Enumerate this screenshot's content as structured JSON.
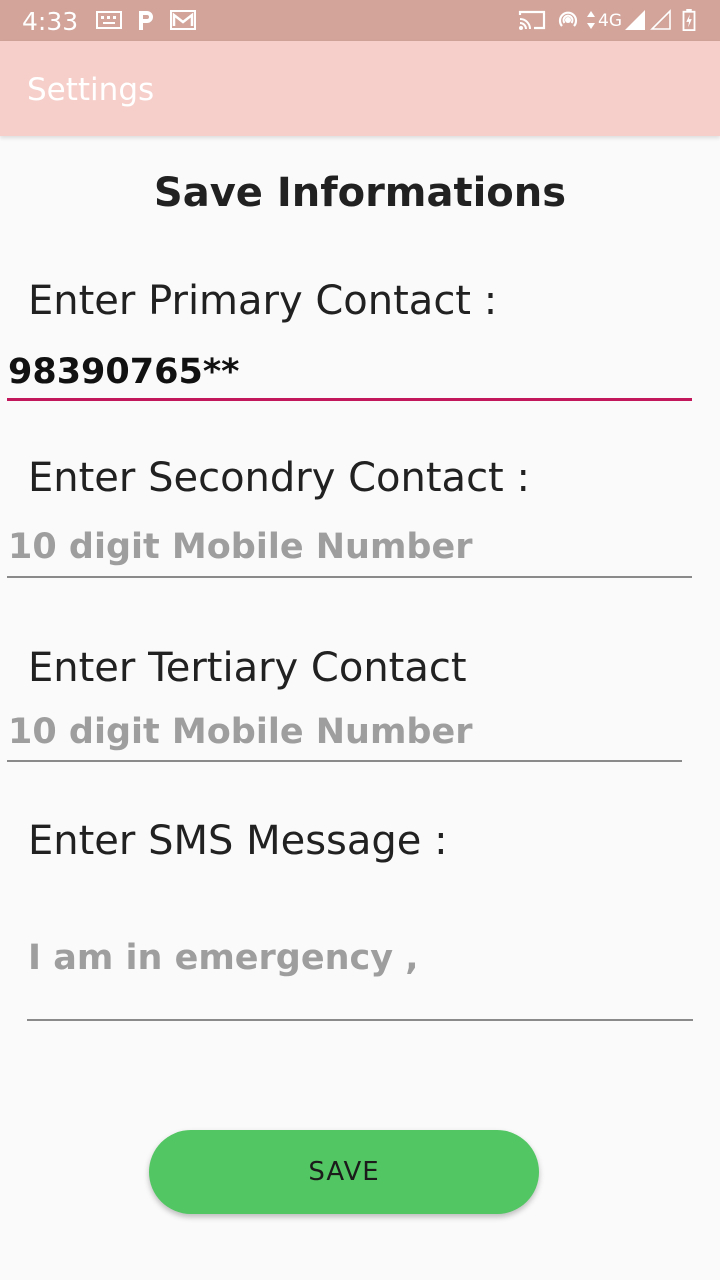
{
  "status_bar": {
    "time": "4:33",
    "network_label": "4G",
    "icons": [
      "keyboard-icon",
      "p-app-icon",
      "gmail-icon",
      "cast-icon",
      "hotspot-icon",
      "data-arrows-icon",
      "signal-icon",
      "signal-empty-icon",
      "battery-icon"
    ]
  },
  "app_bar": {
    "title": "Settings"
  },
  "form": {
    "heading": "Save Informations",
    "primary": {
      "label": "Enter Primary Contact :",
      "value": "98390765**"
    },
    "secondary": {
      "label": "Enter Secondry Contact :",
      "placeholder": "10 digit Mobile Number"
    },
    "tertiary": {
      "label": "Enter Tertiary Contact",
      "placeholder": "10 digit Mobile Number"
    },
    "sms": {
      "label": "Enter SMS Message :",
      "placeholder": "I am in emergency ,"
    },
    "save_label": "SAVE"
  },
  "colors": {
    "status_bar": "#d2a49a",
    "app_bar": "#f6cfca",
    "accent_underline": "#c2185b",
    "save_button": "#51c662"
  }
}
